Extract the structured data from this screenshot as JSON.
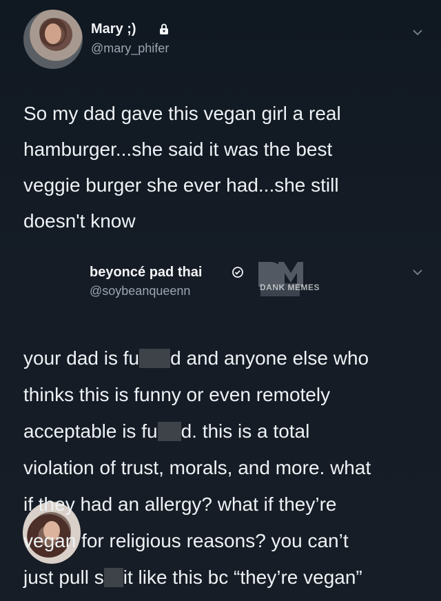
{
  "tweets": [
    {
      "display_name": "Mary ;)",
      "handle": "@mary_phifer",
      "protected_icon": "lock-icon",
      "menu_icon": "chevron-down-icon",
      "text_lines": [
        "So my dad gave this vegan girl a real",
        "hamburger...she said it was the best",
        "veggie burger she ever had...she still",
        "doesn't know"
      ]
    },
    {
      "display_name": "beyoncé pad thai",
      "handle": "@soybeanqueenn",
      "verified_icon": "verified-icon",
      "menu_icon": "chevron-down-icon",
      "text_segments": {
        "line1_a": "your dad is fu",
        "line1_b": "d and anyone else who",
        "line2": "thinks this is funny or even remotely",
        "line3_a": "acceptable is fu",
        "line3_b": "d. this is a total",
        "line4": "violation of trust, morals, and more. what",
        "line5": "if they had an allergy? what if they’re",
        "line6": "vegan for religious reasons? you can’t",
        "line7_a": "just pull s",
        "line7_b": "it like this bc “they’re vegan”"
      }
    }
  ],
  "watermark": {
    "logo_text": "DM",
    "subtext": "DANK MEMES"
  },
  "colors": {
    "background": "#141b24",
    "text": "#eef2f5",
    "handle": "#9aa6b2"
  }
}
